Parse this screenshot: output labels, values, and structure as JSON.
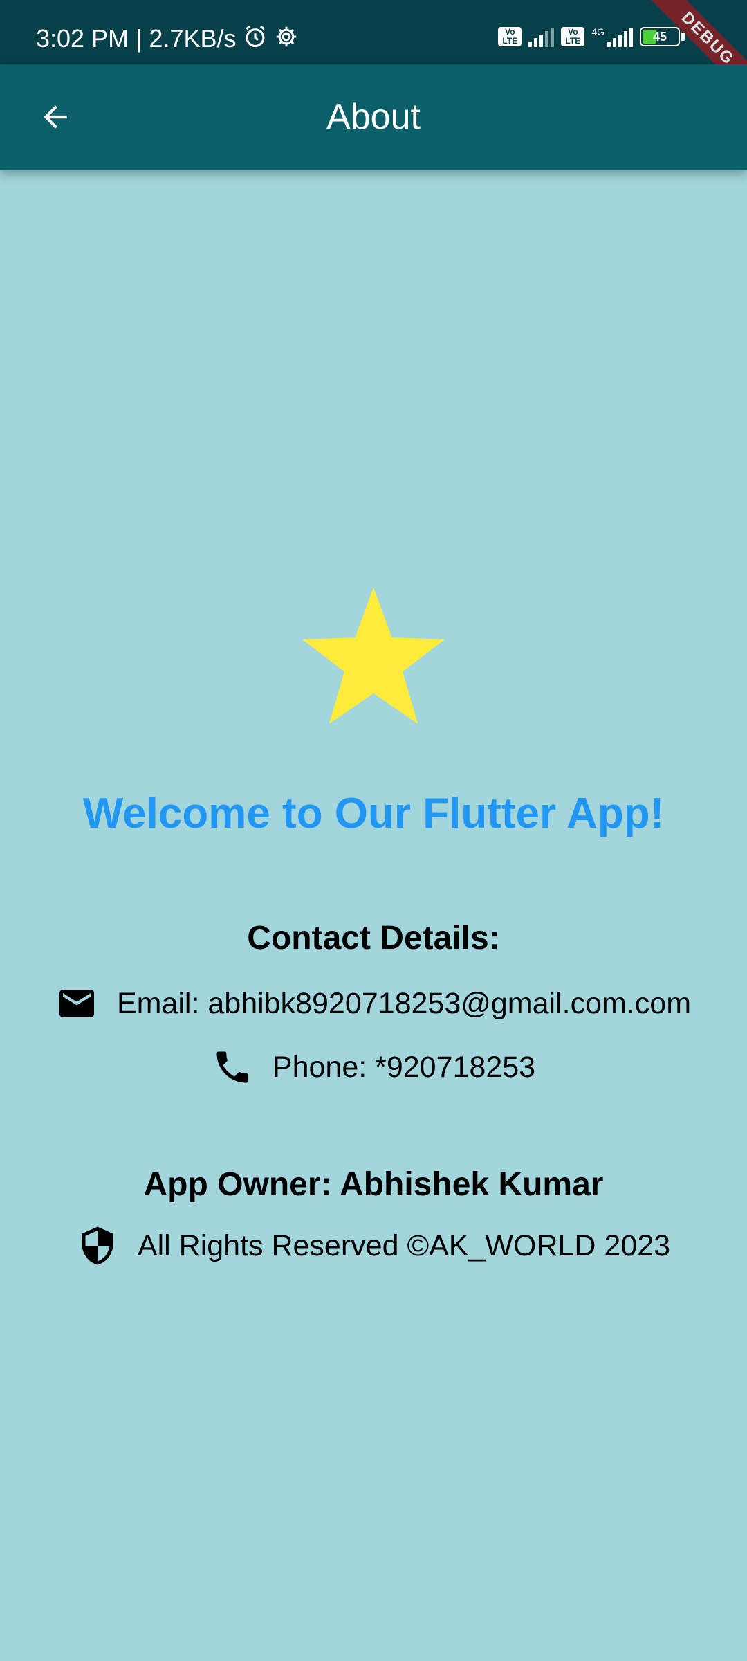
{
  "status_bar": {
    "time_speed": "3:02 PM | 2.7KB/s",
    "volte_label": "Vo LTE",
    "network_label": "4G",
    "battery_level": "45",
    "battery_color": "#4cd137"
  },
  "debug_banner": "DEBUG",
  "app_bar": {
    "title": "About",
    "back_icon": "arrow-back-icon",
    "background": "#0b5f69"
  },
  "content": {
    "star_icon": "star-icon",
    "star_color": "#ffeb3b",
    "welcome": "Welcome to Our Flutter App!",
    "welcome_color": "#2196f3",
    "contact_heading": "Contact Details:",
    "email": "Email: abhibk8920718253@gmail.com.com",
    "email_icon": "email-icon",
    "phone": "Phone: *920718253",
    "phone_icon": "phone-icon",
    "owner": "App Owner: Abhishek Kumar",
    "rights": "All Rights Reserved ©AK_WORLD 2023",
    "rights_icon": "shield-icon"
  },
  "background_color": "#a2d5dc"
}
